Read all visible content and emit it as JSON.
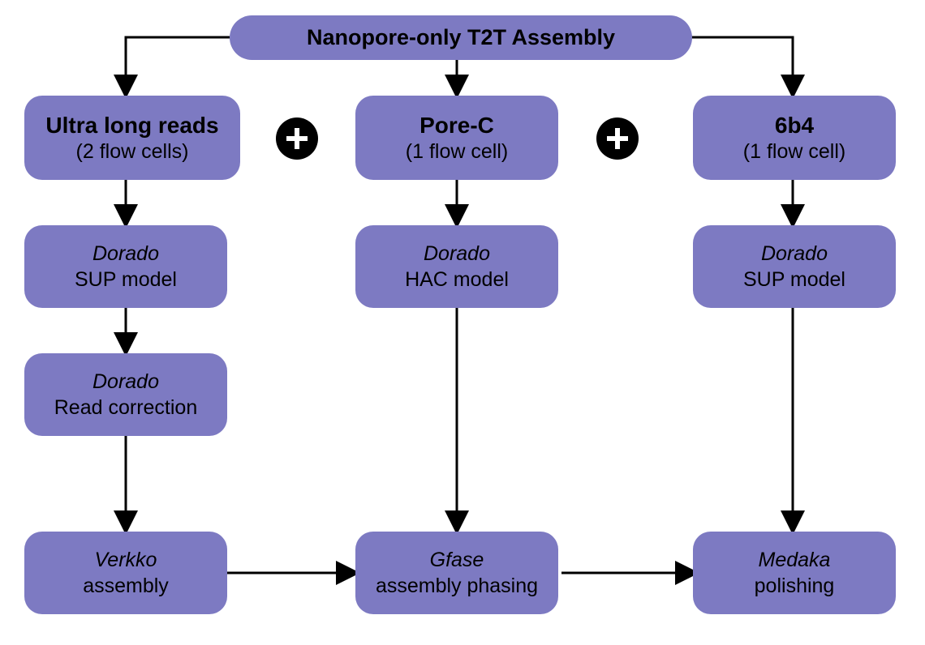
{
  "title": "Nanopore-only T2T Assembly",
  "columns": {
    "left": {
      "input": {
        "name": "Ultra long reads",
        "cells": "(2 flow cells)"
      },
      "steps": [
        {
          "tool": "Dorado",
          "desc": "SUP model"
        },
        {
          "tool": "Dorado",
          "desc": "Read correction"
        },
        {
          "tool": "Verkko",
          "desc": "assembly"
        }
      ]
    },
    "middle": {
      "input": {
        "name": "Pore-C",
        "cells": "(1 flow cell)"
      },
      "steps": [
        {
          "tool": "Dorado",
          "desc": "HAC model"
        },
        {
          "tool": "Gfase",
          "desc": "assembly phasing"
        }
      ]
    },
    "right": {
      "input": {
        "name": "6b4",
        "cells": "(1 flow cell)"
      },
      "steps": [
        {
          "tool": "Dorado",
          "desc": "SUP model"
        },
        {
          "tool": "Medaka",
          "desc": "polishing"
        }
      ]
    }
  },
  "connectors": {
    "plus_symbol": "+"
  }
}
